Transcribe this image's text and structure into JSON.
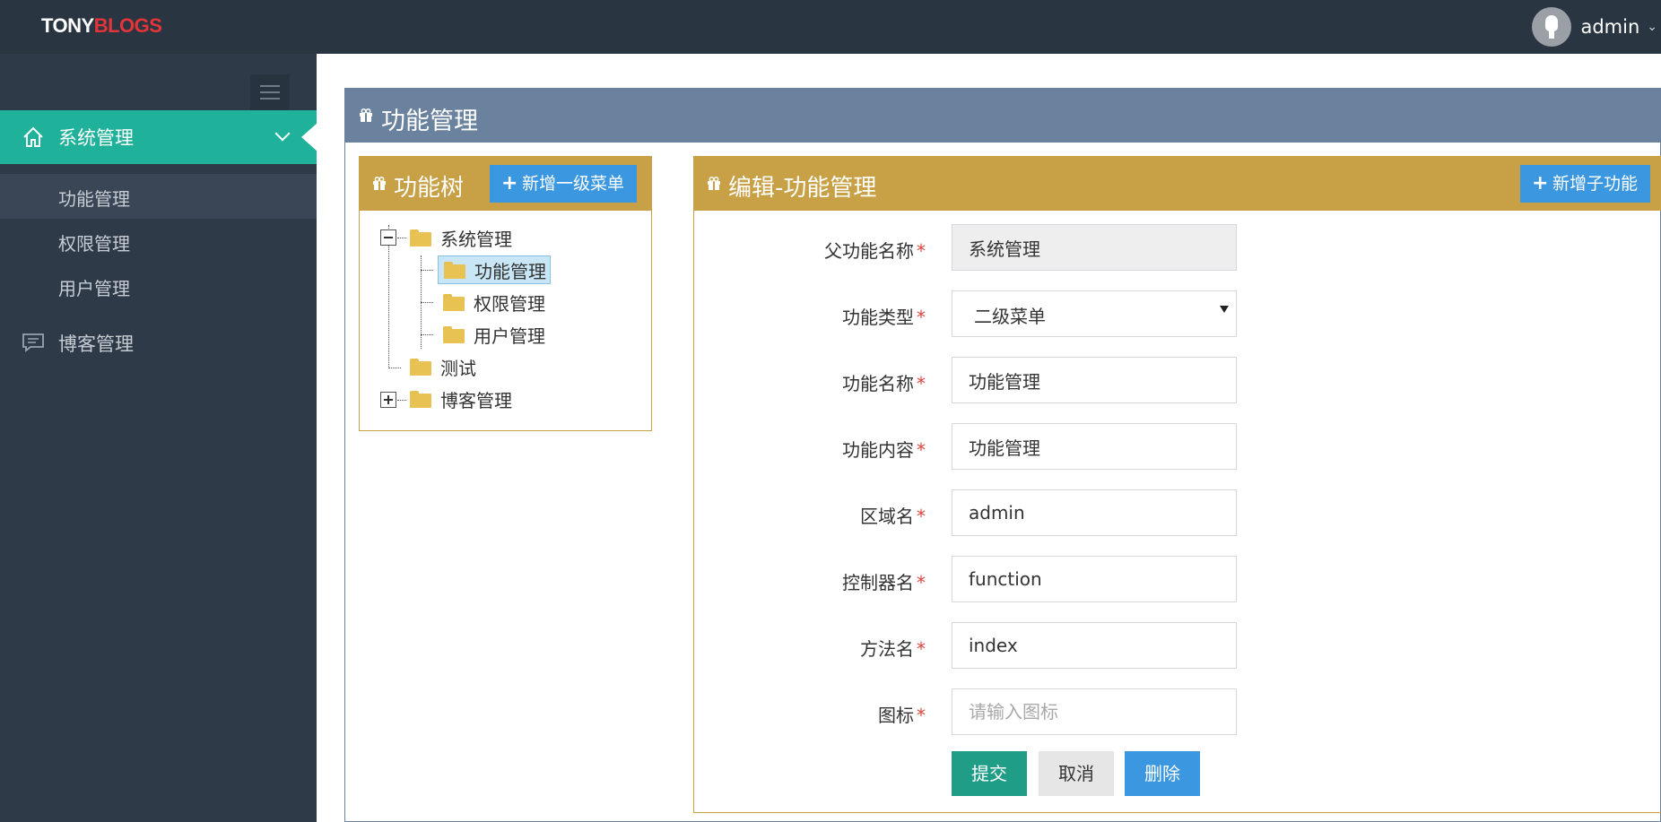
{
  "brand": {
    "part1": "TONY",
    "part2": "BLOGS",
    "color1": "#ffffff",
    "color2": "#e3343a"
  },
  "user": {
    "name": "admin",
    "caret": "⌄"
  },
  "sidebar": {
    "active_menu": {
      "label": "系统管理",
      "icon": "home-icon"
    },
    "sub_items": [
      {
        "label": "功能管理",
        "selected": true
      },
      {
        "label": "权限管理",
        "selected": false
      },
      {
        "label": "用户管理",
        "selected": false
      }
    ],
    "other_menu": {
      "label": "博客管理",
      "icon": "chat-icon"
    }
  },
  "main": {
    "title": "功能管理",
    "tree_panel": {
      "title": "功能树",
      "add_button": "新增一级菜单",
      "nodes": [
        {
          "label": "系统管理",
          "expanded": true
        },
        {
          "label": "功能管理",
          "selected": true
        },
        {
          "label": "权限管理"
        },
        {
          "label": "用户管理"
        },
        {
          "label": "测试"
        },
        {
          "label": "博客管理",
          "expanded": false
        }
      ]
    },
    "form_panel": {
      "title": "编辑-功能管理",
      "add_child_button": "新增子功能",
      "fields": {
        "parent_name": {
          "label": "父功能名称",
          "value": "系统管理"
        },
        "type": {
          "label": "功能类型",
          "value": "二级菜单"
        },
        "name": {
          "label": "功能名称",
          "value": "功能管理"
        },
        "content": {
          "label": "功能内容",
          "value": "功能管理"
        },
        "area": {
          "label": "区域名",
          "value": "admin"
        },
        "controller": {
          "label": "控制器名",
          "value": "function"
        },
        "method": {
          "label": "方法名",
          "value": "index"
        },
        "icon": {
          "label": "图标",
          "value": "",
          "placeholder": "请输入图标"
        }
      },
      "required_mark": "*",
      "buttons": {
        "submit": "提交",
        "cancel": "取消",
        "delete": "删除"
      }
    }
  },
  "colors": {
    "topbar": "#2a3542",
    "sidebar": "#2f3a48",
    "accent_teal": "#1fb19a",
    "panel_header": "#6b829f",
    "panel_gold": "#c8a046",
    "button_blue": "#3a97e0"
  }
}
